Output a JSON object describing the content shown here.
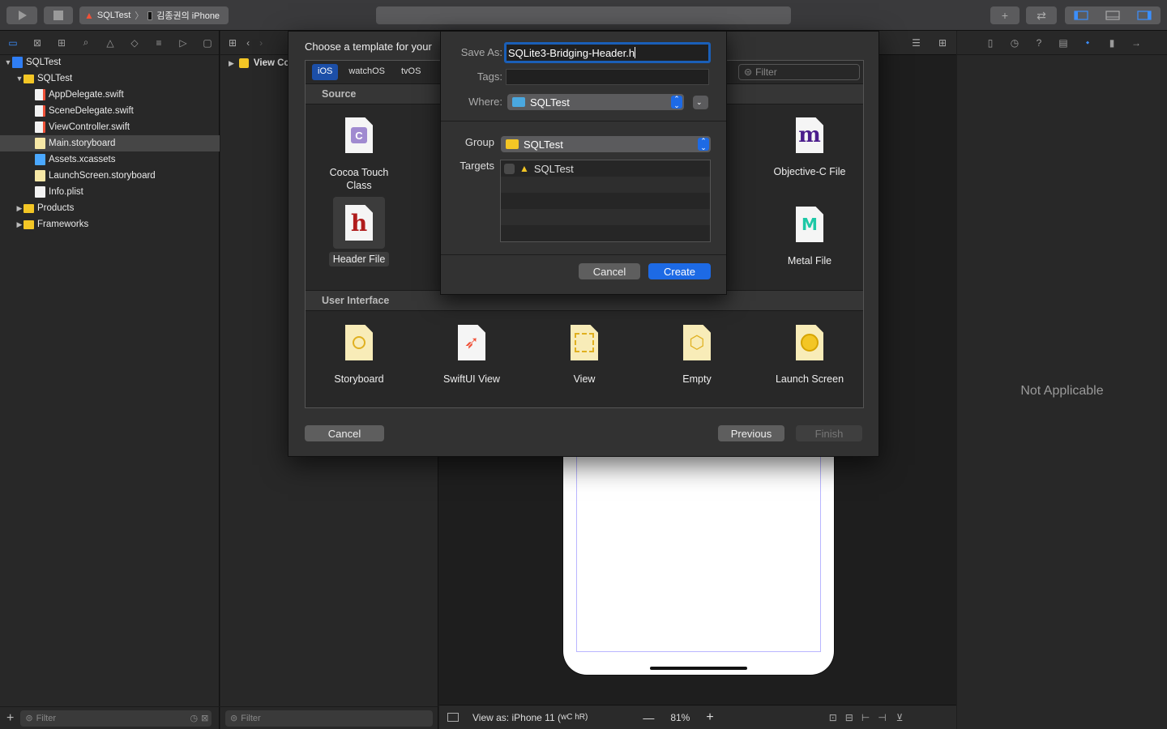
{
  "toolbar": {
    "scheme_project": "SQLTest",
    "scheme_device": "김종권의 iPhone"
  },
  "navigator": {
    "items": [
      {
        "label": "SQLTest",
        "kind": "project",
        "depth": 0,
        "expanded": true
      },
      {
        "label": "SQLTest",
        "kind": "folder",
        "depth": 1,
        "expanded": true
      },
      {
        "label": "AppDelegate.swift",
        "kind": "swift",
        "depth": 2
      },
      {
        "label": "SceneDelegate.swift",
        "kind": "swift",
        "depth": 2
      },
      {
        "label": "ViewController.swift",
        "kind": "swift",
        "depth": 2
      },
      {
        "label": "Main.storyboard",
        "kind": "storyboard",
        "depth": 2,
        "selected": true
      },
      {
        "label": "Assets.xcassets",
        "kind": "assets",
        "depth": 2
      },
      {
        "label": "LaunchScreen.storyboard",
        "kind": "storyboard",
        "depth": 2
      },
      {
        "label": "Info.plist",
        "kind": "plist",
        "depth": 2
      },
      {
        "label": "Products",
        "kind": "folder",
        "depth": 1,
        "expanded": false
      },
      {
        "label": "Frameworks",
        "kind": "folder",
        "depth": 1,
        "expanded": false
      }
    ],
    "filter_placeholder": "Filter"
  },
  "outline": {
    "row_label": "View Co",
    "filter_placeholder": "Filter"
  },
  "canvas": {
    "view_as": "View as: iPhone 11 (",
    "size_class": "wC hR)",
    "zoom": "81%"
  },
  "inspector": {
    "empty_text": "Not Applicable"
  },
  "template_sheet": {
    "title": "Choose a template for your",
    "platforms": [
      "iOS",
      "watchOS",
      "tvOS"
    ],
    "active_platform": "iOS",
    "filter_placeholder": "Filter",
    "source_header": "Source",
    "ui_header": "User Interface",
    "source_items": {
      "cocoa": "Cocoa Touch Class",
      "header": "Header File",
      "objc": "Objective-C File",
      "metal": "Metal File"
    },
    "ui_items": [
      "Storyboard",
      "SwiftUI View",
      "View",
      "Empty",
      "Launch Screen"
    ],
    "cancel": "Cancel",
    "previous": "Previous",
    "finish": "Finish"
  },
  "save_sheet": {
    "save_as_label": "Save As:",
    "save_as_value": "SQLite3-Bridging-Header.h",
    "tags_label": "Tags:",
    "where_label": "Where:",
    "where_value": "SQLTest",
    "group_label": "Group",
    "group_value": "SQLTest",
    "targets_label": "Targets",
    "targets": [
      "SQLTest"
    ],
    "cancel": "Cancel",
    "create": "Create"
  },
  "colors": {
    "accent": "#1d6ae5",
    "folder": "#f3c625",
    "selection": "#464646"
  }
}
